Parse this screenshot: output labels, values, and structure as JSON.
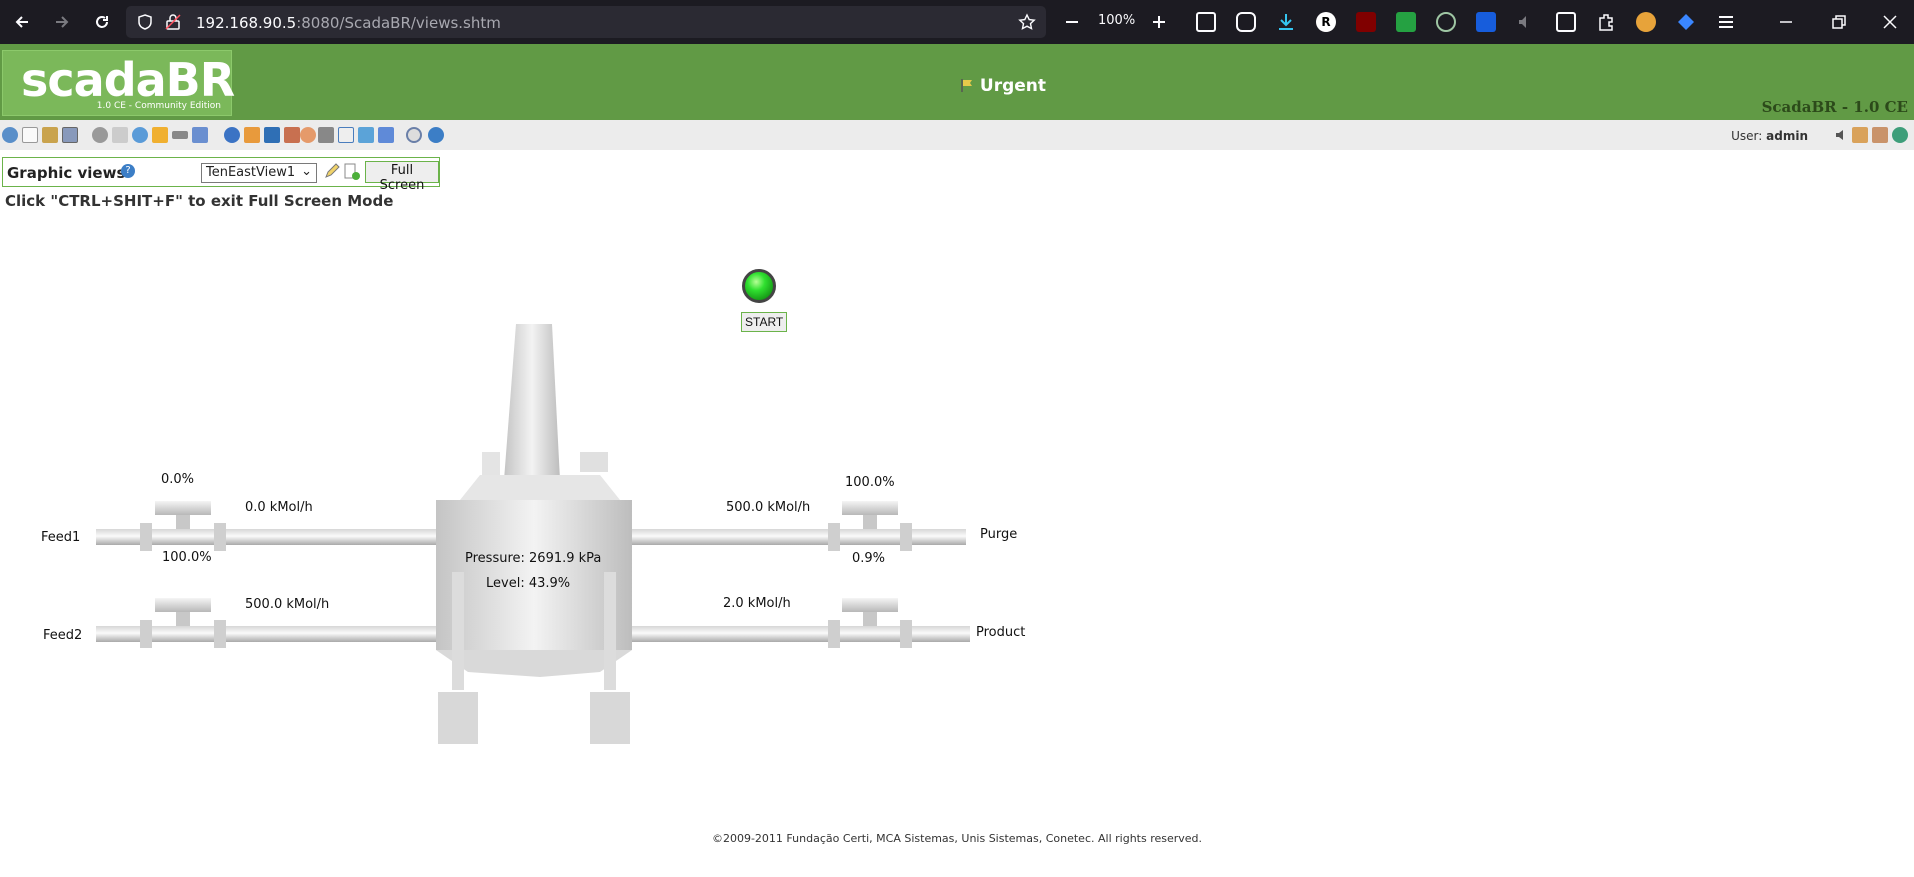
{
  "browser": {
    "url_host": "192.168.90.5",
    "url_path": ":8080/ScadaBR/views.shtm",
    "zoom": "100%"
  },
  "header": {
    "logo_text": "scadaBR",
    "logo_sub": "1.0 CE - Community Edition",
    "alarm_text": "Urgent",
    "version": "ScadaBR - 1.0 CE"
  },
  "user": {
    "label": "User:",
    "name": "admin"
  },
  "graphic_views": {
    "title": "Graphic views",
    "selected_view": "TenEastView1",
    "fullscreen_label": "Full Screen",
    "hint": "Click \"CTRL+SHIT+F\" to exit Full Screen Mode"
  },
  "process": {
    "start_label": "START",
    "feed1": {
      "name": "Feed1",
      "valve": "0.0%",
      "flow": "0.0 kMol/h"
    },
    "feed2": {
      "name": "Feed2",
      "valve": "100.0%",
      "flow": "500.0 kMol/h"
    },
    "purge": {
      "name": "Purge",
      "valve": "100.0%",
      "flow": "500.0 kMol/h"
    },
    "product": {
      "name": "Product",
      "valve": "0.9%",
      "flow": "2.0 kMol/h"
    },
    "pressure": "Pressure: 2691.9 kPa",
    "level": "Level: 43.9%"
  },
  "footer": "©2009-2011 Fundação Certi, MCA Sistemas, Unis Sistemas, Conetec. All rights reserved."
}
